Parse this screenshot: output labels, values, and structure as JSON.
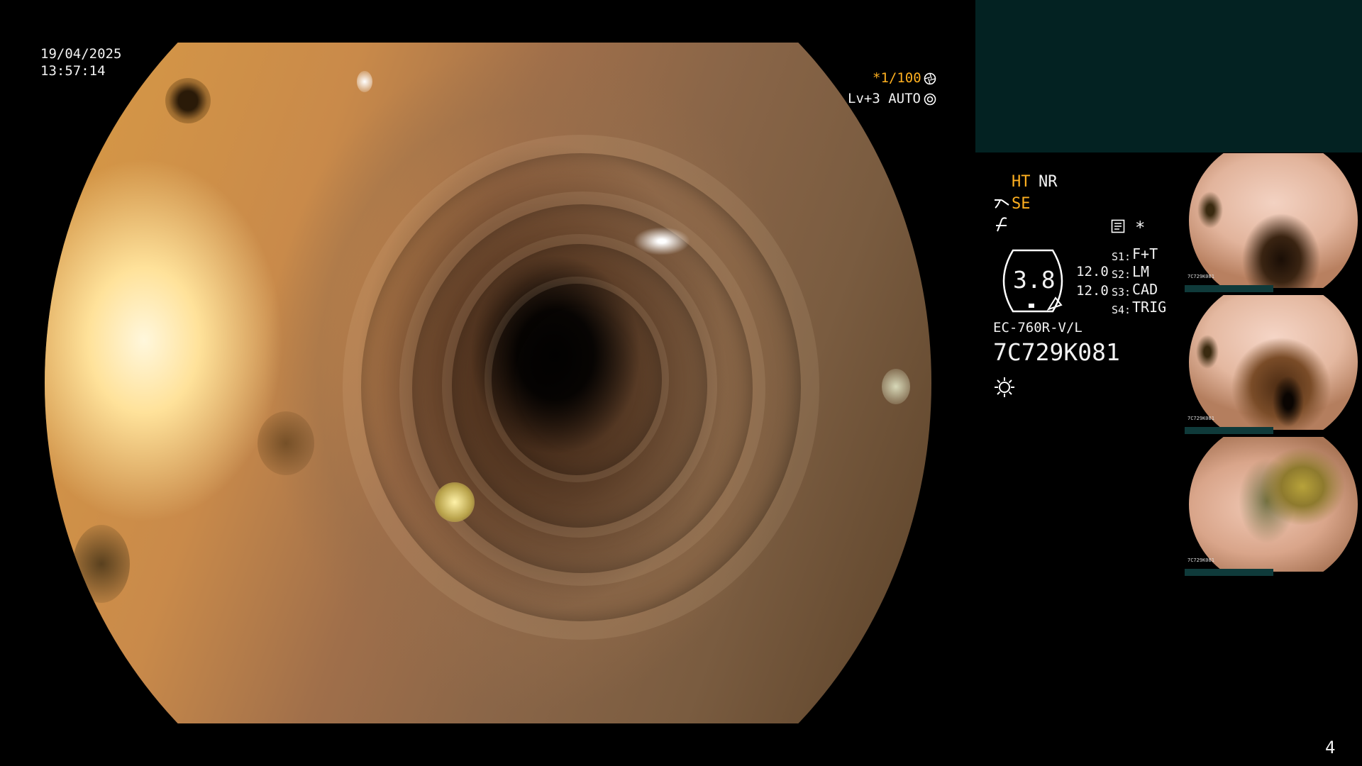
{
  "colors": {
    "accent": "#ffb020",
    "teal": "#032222"
  },
  "overlay": {
    "date": "19/04/2025",
    "time": "13:57:14",
    "shutter": "*1/100",
    "level": "Lv+3 AUTO",
    "ht": "HT",
    "nr": "NR",
    "se": "SE",
    "zoom": "3.8",
    "val1": "12.0",
    "val2": "12.0",
    "s1_label": "S1:",
    "s1_value": "F+T",
    "s2_label": "S2:",
    "s2_value": "LM",
    "s3_label": "S3:",
    "s3_value": "CAD",
    "s4_label": "S4:",
    "s4_value": "TRIG",
    "star": "*",
    "model": "EC-760R-V/L",
    "serial": "7C729K081",
    "page": "4"
  },
  "thumbnails": [
    {
      "caption": "7C729K081"
    },
    {
      "caption": "7C729K081"
    },
    {
      "caption": "7C729K081"
    }
  ],
  "icons": [
    "shutter-icon",
    "auto-iris-icon",
    "scope-tip-icon",
    "bend-icon",
    "memory-icon",
    "light-icon"
  ]
}
